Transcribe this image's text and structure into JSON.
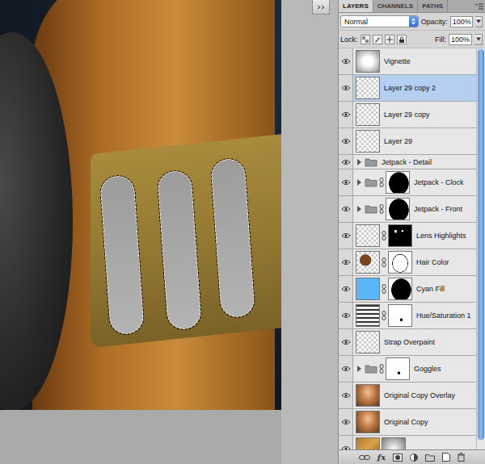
{
  "panel": {
    "tabs": [
      {
        "label": "LAYERS",
        "selected": true
      },
      {
        "label": "CHANNELS",
        "selected": false
      },
      {
        "label": "PATHS",
        "selected": false
      }
    ],
    "blend_mode": "Normal",
    "opacity_label": "Opacity:",
    "opacity": "100%",
    "lock_label": "Lock:",
    "fill_label": "Fill:",
    "fill": "100%"
  },
  "layers": [
    {
      "name": "Vignette",
      "kind": "layer",
      "thumb": "vignette",
      "mask": "none",
      "visible": true,
      "selected": false
    },
    {
      "name": "Layer 29 copy 2",
      "kind": "layer",
      "thumb": "transparent",
      "mask": "none",
      "visible": true,
      "selected": true
    },
    {
      "name": "Layer 29 copy",
      "kind": "layer",
      "thumb": "transparent",
      "mask": "none",
      "visible": true,
      "selected": false
    },
    {
      "name": "Layer 29",
      "kind": "layer",
      "thumb": "transparent",
      "mask": "none",
      "visible": true,
      "selected": false
    },
    {
      "name": "Jetpack - Detail",
      "kind": "group",
      "thumb": "none",
      "mask": "none",
      "visible": true,
      "selected": false,
      "expanded": false
    },
    {
      "name": "Jetpack - Clock",
      "kind": "group",
      "thumb": "none",
      "mask": "silhouette",
      "visible": true,
      "selected": false,
      "expanded": false
    },
    {
      "name": "Jetpack - Front",
      "kind": "group",
      "thumb": "none",
      "mask": "silhouette",
      "visible": true,
      "selected": false,
      "expanded": false
    },
    {
      "name": "Lens Highlights",
      "kind": "layer",
      "thumb": "transparent",
      "mask": "black",
      "visible": true,
      "selected": false
    },
    {
      "name": "Hair Color",
      "kind": "layer",
      "thumb": "hair",
      "mask": "outline",
      "visible": true,
      "selected": false
    },
    {
      "name": "Cyan Fill",
      "kind": "layer",
      "thumb": "fill",
      "color": "#5ab6f6",
      "mask": "silhouette",
      "visible": true,
      "selected": false
    },
    {
      "name": "Hue/Saturation 1",
      "kind": "layer",
      "thumb": "adjustment",
      "mask": "white",
      "visible": true,
      "selected": false
    },
    {
      "name": "Strap Overpaint",
      "kind": "layer",
      "thumb": "transparent",
      "mask": "none",
      "visible": true,
      "selected": false
    },
    {
      "name": "Goggles",
      "kind": "group",
      "thumb": "none",
      "mask": "white",
      "visible": true,
      "selected": false,
      "expanded": false
    },
    {
      "name": "Original Copy Overlay",
      "kind": "layer",
      "thumb": "photo",
      "mask": "none",
      "visible": true,
      "selected": false
    },
    {
      "name": "Original Copy",
      "kind": "layer",
      "thumb": "photo",
      "mask": "none",
      "visible": true,
      "selected": false
    },
    {
      "name": "",
      "kind": "layer",
      "thumb": "texture",
      "mask": "gradient",
      "visible": true,
      "selected": false
    }
  ],
  "bottom_bar": {
    "fx": "fx"
  }
}
